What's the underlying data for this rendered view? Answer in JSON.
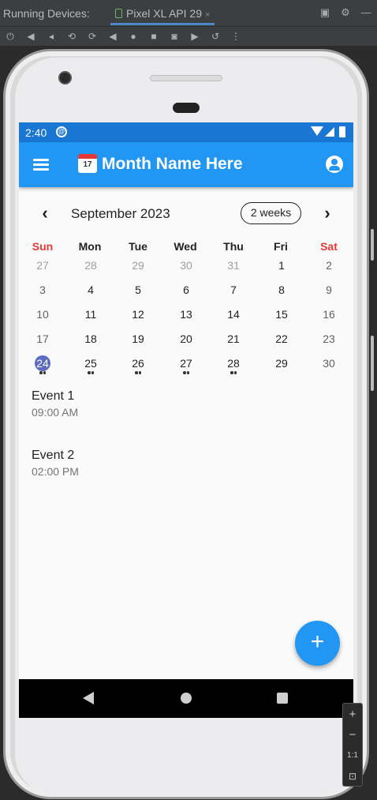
{
  "ide": {
    "title": "Running Devices:",
    "device_tab": "Pixel XL API 29",
    "tab_close": "×",
    "right_icons": [
      "restore-icon",
      "gear-icon",
      "minimize-icon"
    ],
    "toolbar_icons": [
      "power-icon",
      "volume-up-icon",
      "volume-down-icon",
      "rotate-left-icon",
      "rotate-right-icon",
      "back-icon",
      "home-icon",
      "overview-icon",
      "screenshot-icon",
      "record-icon",
      "reset-icon",
      "more-icon"
    ]
  },
  "status": {
    "time": "2:40",
    "app_icon_glyph": "@"
  },
  "appbar": {
    "emoji_number": "17",
    "title": "Month Name Here"
  },
  "calendar": {
    "prev": "‹",
    "next": "›",
    "month_label": "September 2023",
    "format_button": "2 weeks",
    "days_of_week": [
      "Sun",
      "Mon",
      "Tue",
      "Wed",
      "Thu",
      "Fri",
      "Sat"
    ],
    "weeks": [
      [
        "27",
        "28",
        "29",
        "30",
        "31",
        "1",
        "2"
      ],
      [
        "3",
        "4",
        "5",
        "6",
        "7",
        "8",
        "9"
      ],
      [
        "10",
        "11",
        "12",
        "13",
        "14",
        "15",
        "16"
      ],
      [
        "17",
        "18",
        "19",
        "20",
        "21",
        "22",
        "23"
      ],
      [
        "24",
        "25",
        "26",
        "27",
        "28",
        "29",
        "30"
      ]
    ],
    "today": "24"
  },
  "events": [
    {
      "title": "Event 1",
      "time": "09:00 AM"
    },
    {
      "title": "Event 2",
      "time": "02:00 PM"
    }
  ],
  "fab_label": "+",
  "zoom": {
    "plus": "+",
    "minus": "−",
    "one_to_one": "1:1"
  },
  "colors": {
    "primary": "#2196f3",
    "status_bar": "#1976d2",
    "weekend_label": "#e53935",
    "today": "#5c6bc0"
  }
}
